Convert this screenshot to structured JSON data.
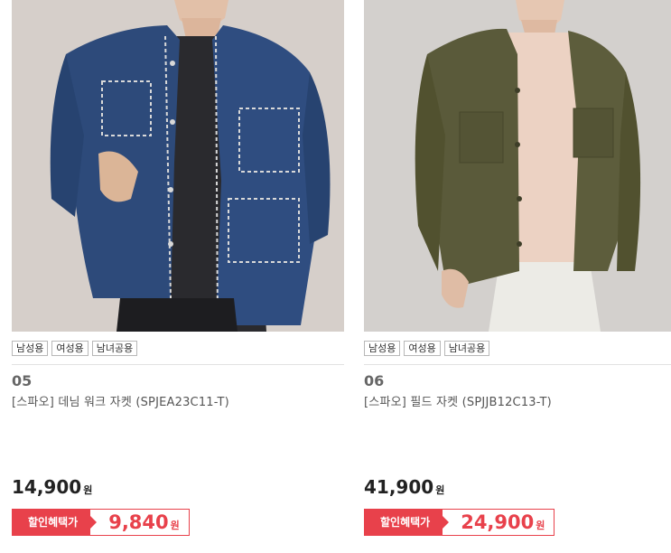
{
  "products": [
    {
      "tags": [
        "남성용",
        "여성용",
        "남녀공용"
      ],
      "number": "05",
      "name": "[스파오] 데님 워크 자켓 (SPJEA23C11-T)",
      "price": "14,900",
      "currency": "원",
      "discount_label": "할인혜택가",
      "discount_price": "9,840",
      "discount_currency": "원",
      "image_icon": "denim-jacket-photo"
    },
    {
      "tags": [
        "남성용",
        "여성용",
        "남녀공용"
      ],
      "number": "06",
      "name": "[스파오] 필드 자켓 (SPJJB12C13-T)",
      "price": "41,900",
      "currency": "원",
      "discount_label": "할인혜택가",
      "discount_price": "24,900",
      "discount_currency": "원",
      "image_icon": "field-jacket-photo"
    }
  ],
  "colors": {
    "accent": "#e8414b",
    "denim": "#2d4a7a",
    "olive": "#5a5a3a"
  }
}
